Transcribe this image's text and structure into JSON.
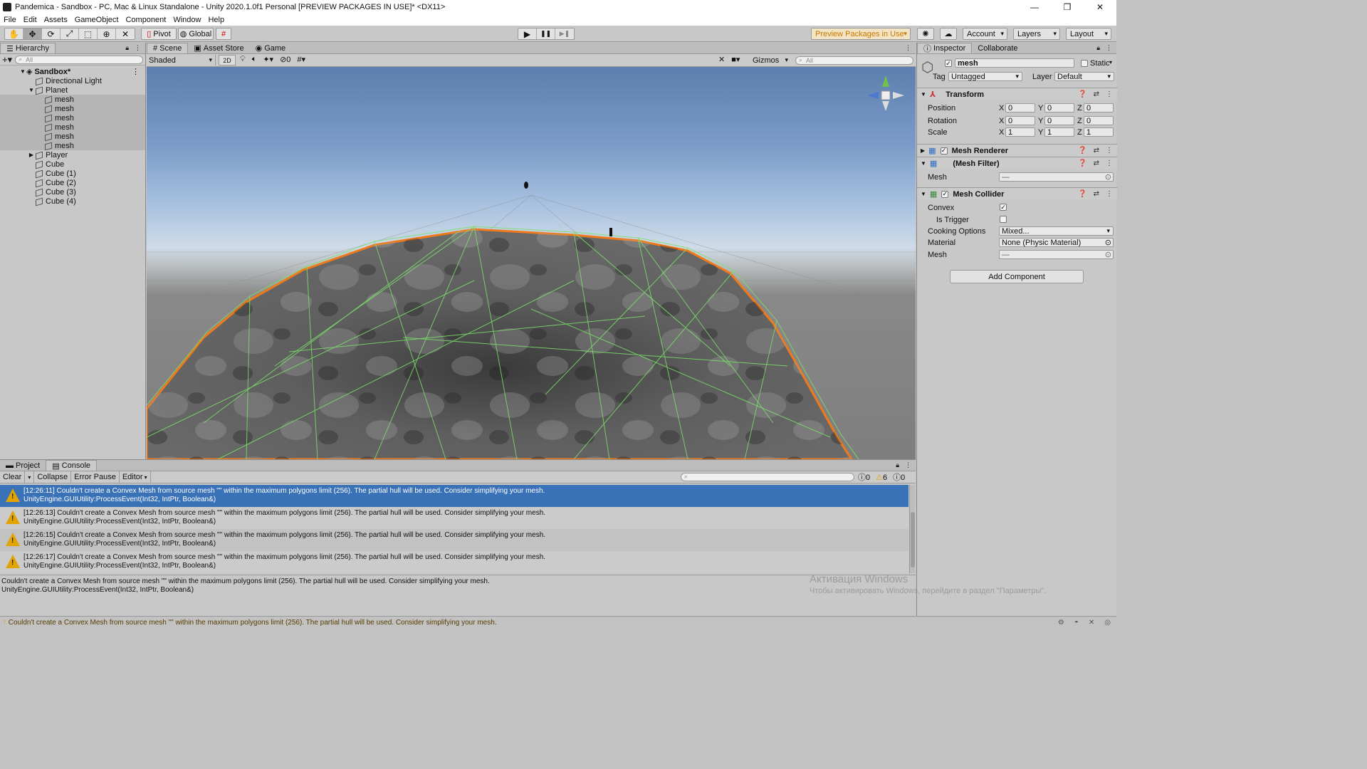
{
  "window": {
    "title": "Pandemica - Sandbox - PC, Mac & Linux Standalone - Unity 2020.1.0f1 Personal [PREVIEW PACKAGES IN USE]* <DX11>",
    "controls": [
      "—",
      "❐",
      "✕"
    ]
  },
  "menu": [
    "File",
    "Edit",
    "Assets",
    "GameObject",
    "Component",
    "Window",
    "Help"
  ],
  "toolbar": {
    "tools": [
      "hand-tool",
      "move-tool",
      "rotate-tool",
      "scale-tool",
      "rect-tool",
      "transform-tool",
      "custom-tool"
    ],
    "pivot": "Pivot",
    "global": "Global",
    "play_controls": [
      "▶",
      "❚❚",
      "▶❚"
    ],
    "preview_packages": "Preview Packages in Use",
    "account": "Account",
    "layers": "Layers",
    "layout": "Layout"
  },
  "hierarchy": {
    "tab": "Hierarchy",
    "search_placeholder": "All",
    "scene": "Sandbox*",
    "items": [
      {
        "label": "Directional Light",
        "indent": 1
      },
      {
        "label": "Planet",
        "indent": 1,
        "expanded": true
      },
      {
        "label": "mesh",
        "indent": 2
      },
      {
        "label": "mesh",
        "indent": 2
      },
      {
        "label": "mesh",
        "indent": 2
      },
      {
        "label": "mesh",
        "indent": 2
      },
      {
        "label": "mesh",
        "indent": 2
      },
      {
        "label": "mesh",
        "indent": 2
      },
      {
        "label": "Player",
        "indent": 1,
        "collapsed": true
      },
      {
        "label": "Cube",
        "indent": 1
      },
      {
        "label": "Cube (1)",
        "indent": 1
      },
      {
        "label": "Cube (2)",
        "indent": 1
      },
      {
        "label": "Cube (3)",
        "indent": 1
      },
      {
        "label": "Cube (4)",
        "indent": 1
      }
    ]
  },
  "scene_view": {
    "tabs": [
      "Scene",
      "Asset Store",
      "Game"
    ],
    "active_tab": "Scene",
    "draw_mode": "Shaded",
    "mode_2d": "2D",
    "hidden_count": "0",
    "gizmos": "Gizmos",
    "search_placeholder": "All"
  },
  "inspector": {
    "tabs": [
      "Inspector",
      "Collaborate"
    ],
    "object_name": "mesh",
    "static_label": "Static",
    "tag_label": "Tag",
    "tag_value": "Untagged",
    "layer_label": "Layer",
    "layer_value": "Default",
    "transform": {
      "title": "Transform",
      "position_label": "Position",
      "rotation_label": "Rotation",
      "scale_label": "Scale",
      "position": [
        "0",
        "0",
        "0"
      ],
      "rotation": [
        "0",
        "0",
        "0"
      ],
      "scale": [
        "1",
        "1",
        "1"
      ],
      "axes": [
        "X",
        "Y",
        "Z"
      ]
    },
    "mesh_renderer": "Mesh Renderer",
    "mesh_filter": {
      "title": "(Mesh Filter)",
      "mesh_label": "Mesh",
      "mesh_value": "—"
    },
    "mesh_collider": {
      "title": "Mesh Collider",
      "convex_label": "Convex",
      "convex": true,
      "is_trigger_label": "Is Trigger",
      "is_trigger": false,
      "cooking_label": "Cooking Options",
      "cooking_value": "Mixed...",
      "material_label": "Material",
      "material_value": "None (Physic Material)",
      "mesh_label": "Mesh",
      "mesh_value": "—"
    },
    "add_component": "Add Component"
  },
  "console": {
    "tabs": [
      "Project",
      "Console"
    ],
    "active_tab": "Console",
    "buttons": [
      "Clear",
      "Collapse",
      "Error Pause",
      "Editor"
    ],
    "counts": {
      "info": "0",
      "warnings": "6",
      "errors": "0"
    },
    "logs": [
      {
        "line1": "[12:26:11] Couldn't create a Convex Mesh from source mesh \"\" within the maximum polygons limit (256). The partial hull will be used. Consider simplifying your mesh.",
        "line2": "UnityEngine.GUIUtility:ProcessEvent(Int32, IntPtr, Boolean&)",
        "selected": true
      },
      {
        "line1": "[12:26:13] Couldn't create a Convex Mesh from source mesh \"\" within the maximum polygons limit (256). The partial hull will be used. Consider simplifying your mesh.",
        "line2": "UnityEngine.GUIUtility:ProcessEvent(Int32, IntPtr, Boolean&)"
      },
      {
        "line1": "[12:26:15] Couldn't create a Convex Mesh from source mesh \"\" within the maximum polygons limit (256). The partial hull will be used. Consider simplifying your mesh.",
        "line2": "UnityEngine.GUIUtility:ProcessEvent(Int32, IntPtr, Boolean&)"
      },
      {
        "line1": "[12:26:17] Couldn't create a Convex Mesh from source mesh \"\" within the maximum polygons limit (256). The partial hull will be used. Consider simplifying your mesh.",
        "line2": "UnityEngine.GUIUtility:ProcessEvent(Int32, IntPtr, Boolean&)"
      }
    ],
    "detail_line1": "Couldn't create a Convex Mesh from source mesh \"\" within the maximum polygons limit (256). The partial hull will be used. Consider simplifying your mesh.",
    "detail_line2": "UnityEngine.GUIUtility:ProcessEvent(Int32, IntPtr, Boolean&)"
  },
  "watermark": {
    "line1": "Активация Windows",
    "line2": "Чтобы активировать Windows, перейдите в раздел \"Параметры\"."
  },
  "status_bar": "Couldn't create a Convex Mesh from source mesh \"\" within the maximum polygons limit (256). The partial hull will be used. Consider simplifying your mesh.",
  "colors": {
    "selection_blue": "#3a72b8",
    "warning_yellow": "#e2a400",
    "wireframe_green": "#7be06a",
    "selection_orange": "#f07a1a"
  }
}
